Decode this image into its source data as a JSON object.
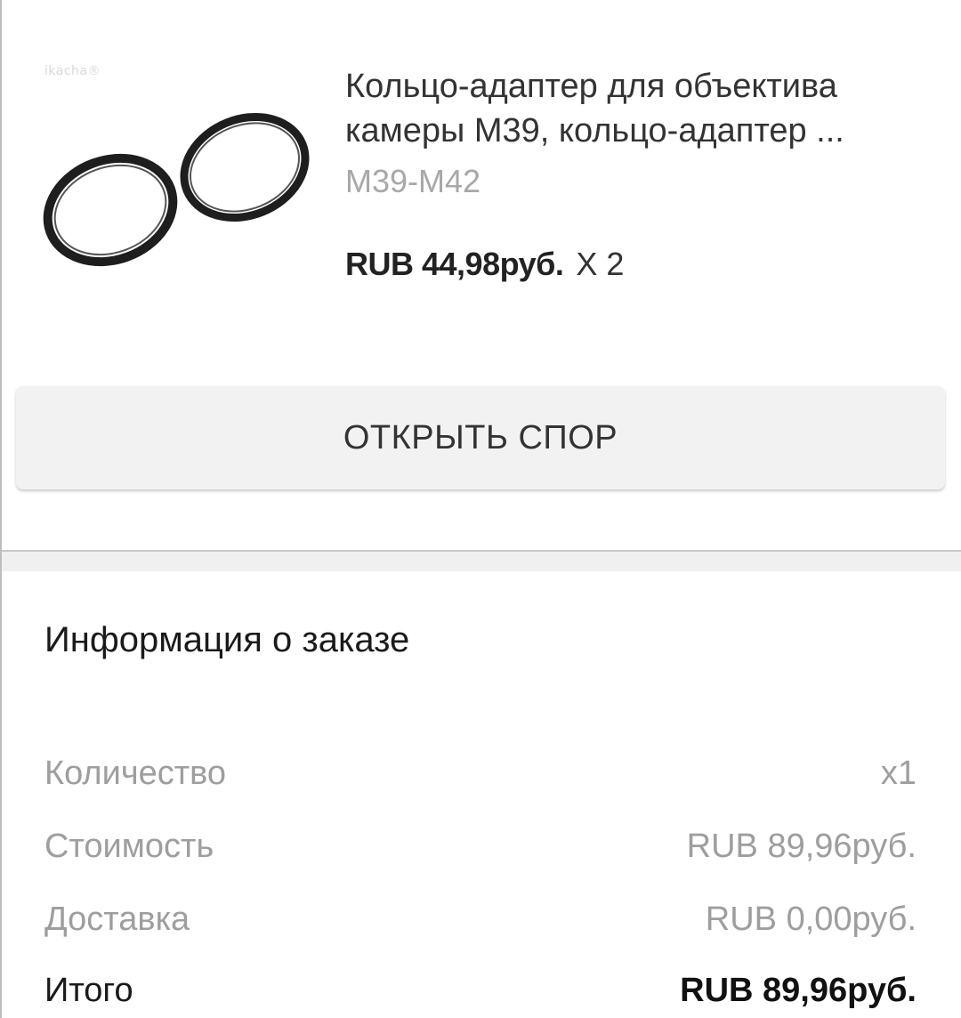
{
  "product": {
    "image_icon": "lens-adapter-rings-image",
    "watermark": "ikacha®",
    "title": "Кольцо-адаптер для объектива камеры М39, кольцо-адаптер ...",
    "variant": "M39-M42",
    "price": "RUB 44,98руб.",
    "quantity": "X 2"
  },
  "actions": {
    "dispute_label": "ОТКРЫТЬ СПОР"
  },
  "order_info": {
    "title": "Информация о заказе",
    "rows": [
      {
        "label": "Количество",
        "value": "x1"
      },
      {
        "label": "Стоимость",
        "value": "RUB 89,96руб."
      },
      {
        "label": "Доставка",
        "value": "RUB 0,00руб."
      },
      {
        "label": "Итого",
        "value": "RUB 89,96руб."
      }
    ]
  },
  "colors": {
    "background": "#ffffff",
    "button_bg": "#f2f2f2",
    "muted_text": "#9e9e9e",
    "primary_text": "#333333"
  }
}
